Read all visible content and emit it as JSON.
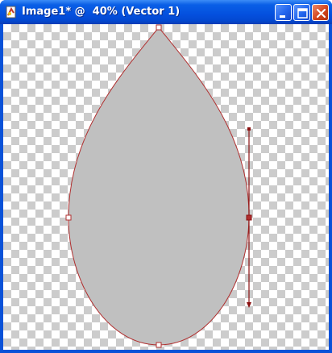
{
  "window": {
    "title": "Image1* @  40% (Vector 1)",
    "app_icon": "paint-document-icon",
    "buttons": {
      "minimize": "minimize-icon",
      "maximize": "maximize-icon",
      "close": "close-icon"
    }
  },
  "colors": {
    "titlebar": "#0a52d8",
    "shape_fill": "#c0c0c0",
    "path_stroke": "#b03030",
    "checker": "#cccccc"
  }
}
